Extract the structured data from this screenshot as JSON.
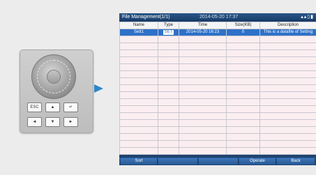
{
  "remote": {
    "esc_label": "ESC",
    "up_label": "▲",
    "enter_label": "↵",
    "left_label": "◄",
    "down_label": "▼",
    "right_label": "►"
  },
  "screen": {
    "title": "File Management(1/1)",
    "datetime": "2014-05-20 17:37",
    "status_icons": "▴▴▯▮",
    "columns": [
      "Name",
      "Type",
      "Time",
      "Size(KB)",
      "Description"
    ],
    "rows": [
      [
        "Sett1",
        "SET",
        "2014-05-20 16:23",
        "0",
        "This is a datafile of Setting"
      ],
      [
        "",
        "",
        "",
        "",
        ""
      ],
      [
        "",
        "",
        "",
        "",
        ""
      ],
      [
        "",
        "",
        "",
        "",
        ""
      ],
      [
        "",
        "",
        "",
        "",
        ""
      ],
      [
        "",
        "",
        "",
        "",
        ""
      ],
      [
        "",
        "",
        "",
        "",
        ""
      ],
      [
        "",
        "",
        "",
        "",
        ""
      ],
      [
        "",
        "",
        "",
        "",
        ""
      ],
      [
        "",
        "",
        "",
        "",
        ""
      ],
      [
        "",
        "",
        "",
        "",
        ""
      ],
      [
        "",
        "",
        "",
        "",
        ""
      ],
      [
        "",
        "",
        "",
        "",
        ""
      ],
      [
        "",
        "",
        "",
        "",
        ""
      ],
      [
        "",
        "",
        "",
        "",
        ""
      ],
      [
        "",
        "",
        "",
        "",
        ""
      ],
      [
        "",
        "",
        "",
        "",
        ""
      ],
      [
        "",
        "",
        "",
        "",
        ""
      ]
    ],
    "buttons": {
      "sort": "Sort",
      "operate": "Operate",
      "back": "Back"
    }
  },
  "colors": {
    "accent_arrow": "#2f86c9",
    "selected_row": "#2e71c8",
    "row_background": "#fbeef1",
    "title_bar": "#1f4370"
  }
}
